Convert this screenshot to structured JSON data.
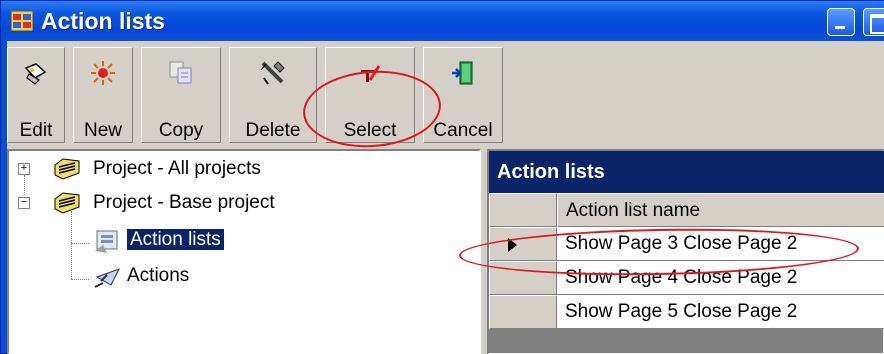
{
  "window": {
    "title": "Action lists"
  },
  "toolbar": {
    "buttons": [
      {
        "label": "Edit",
        "icon": "edit-icon"
      },
      {
        "label": "New",
        "icon": "new-icon"
      },
      {
        "label": "Copy",
        "icon": "copy-icon"
      },
      {
        "label": "Delete",
        "icon": "delete-icon"
      },
      {
        "label": "Select",
        "icon": "select-icon"
      },
      {
        "label": "Cancel",
        "icon": "cancel-icon"
      }
    ]
  },
  "tree": {
    "items": [
      {
        "label": "Project - All projects",
        "expander": "+",
        "icon": "project-icon"
      },
      {
        "label": "Project - Base project",
        "expander": "−",
        "icon": "project-icon"
      },
      {
        "label": "Action lists",
        "icon": "action-lists-icon",
        "selected": true
      },
      {
        "label": "Actions",
        "icon": "actions-icon"
      }
    ]
  },
  "grid": {
    "caption": "Action lists",
    "column_header": "Action list name",
    "rows": [
      "Show Page 3 Close Page 2",
      "Show Page 4 Close Page 2",
      "Show Page 5 Close Page 2"
    ],
    "current_row": 0
  },
  "colors": {
    "titlebar": "#0a58e0",
    "selection": "#0a246a",
    "annotation": "#e3141c",
    "face": "#d4d0c8"
  }
}
